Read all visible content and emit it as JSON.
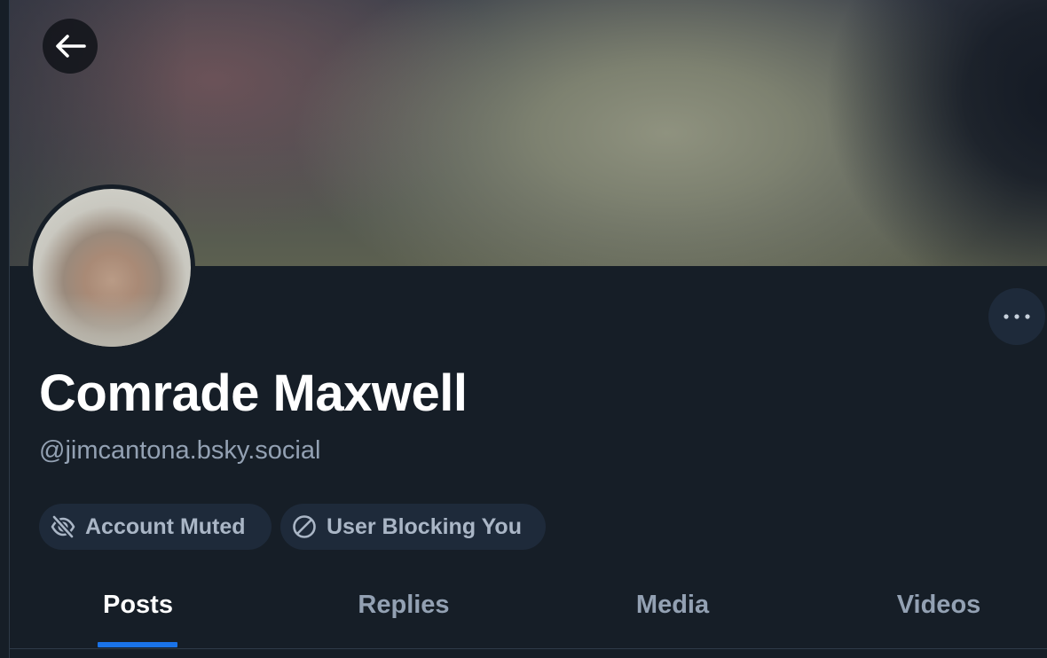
{
  "profile": {
    "display_name": "Comrade Maxwell",
    "handle": "@jimcantona.bsky.social"
  },
  "badges": [
    {
      "label": "Account Muted",
      "icon": "eye-slash-icon"
    },
    {
      "label": "User Blocking You",
      "icon": "block-icon"
    }
  ],
  "tabs": [
    {
      "label": "Posts",
      "active": true
    },
    {
      "label": "Replies",
      "active": false
    },
    {
      "label": "Media",
      "active": false
    },
    {
      "label": "Videos",
      "active": false
    }
  ],
  "icons": {
    "back": "arrow-left-icon",
    "more": "ellipsis-icon"
  },
  "colors": {
    "background": "#161e27",
    "pill_background": "#1e2a3a",
    "muted_text": "#93a1b3",
    "active_tab_indicator": "#1a73e8"
  }
}
